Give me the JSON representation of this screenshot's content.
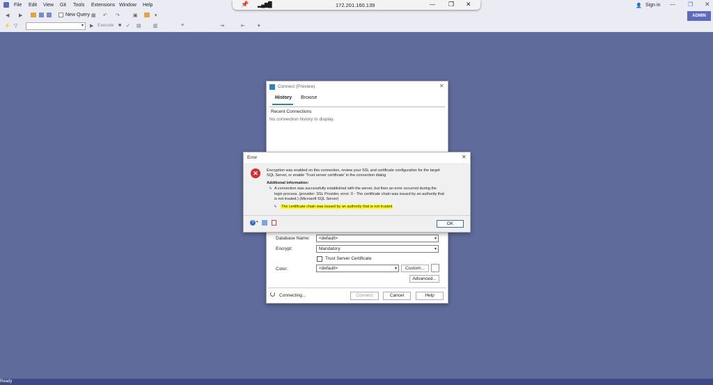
{
  "menu": {
    "items": [
      "File",
      "Edit",
      "View",
      "Git",
      "Tools",
      "Extensions",
      "Window",
      "Help"
    ],
    "new_query": "New Query",
    "execute": "Execute",
    "sign_in": "Sign in",
    "account": "ADMIN"
  },
  "rdp_bar": {
    "address": "172.201.160.139"
  },
  "connect_dialog": {
    "title": "Connect (Preview)",
    "tabs": [
      "History",
      "Browse"
    ],
    "recent_header": "Recent Connections",
    "empty_text": "No connection history to display.",
    "database_label": "Database Name:",
    "database_value": "<default>",
    "encrypt_label": "Encrypt:",
    "encrypt_value": "Mandatory",
    "trust_label": "Trust Server Certificate",
    "color_label": "Color:",
    "color_value": "<default>",
    "custom_button": "Custom...",
    "advanced_button": "Advanced...",
    "connecting_text": "Connecting...",
    "connect_button": "Connect",
    "cancel_button": "Cancel",
    "help_button": "Help"
  },
  "error_dialog": {
    "title": "Error",
    "message_line1": "Encryption was enabled on this connection, review your SSL and certificate configuration for the target",
    "message_line2": "SQL Server, or enable 'Trust server certificate' in the connection dialog",
    "additional_header": "Additional information:",
    "detail_line1": "A connection was successfully established with the server, but then an error occurred during the",
    "detail_line2": "login process. (provider: SSL Provider, error: 0 - The certificate chain was issued by an authority that",
    "detail_line3": "is not trusted.) (Microsoft SQL Server)",
    "highlight_text": "The certificate chain was issued by an authority that is not trusted",
    "ok_button": "OK"
  },
  "status": {
    "text": "Ready"
  },
  "colors": {
    "workspace": "#5f6b9b",
    "accent": "#5c6bc0",
    "highlight": "#ffff00",
    "error_red": "#d32f2f"
  }
}
